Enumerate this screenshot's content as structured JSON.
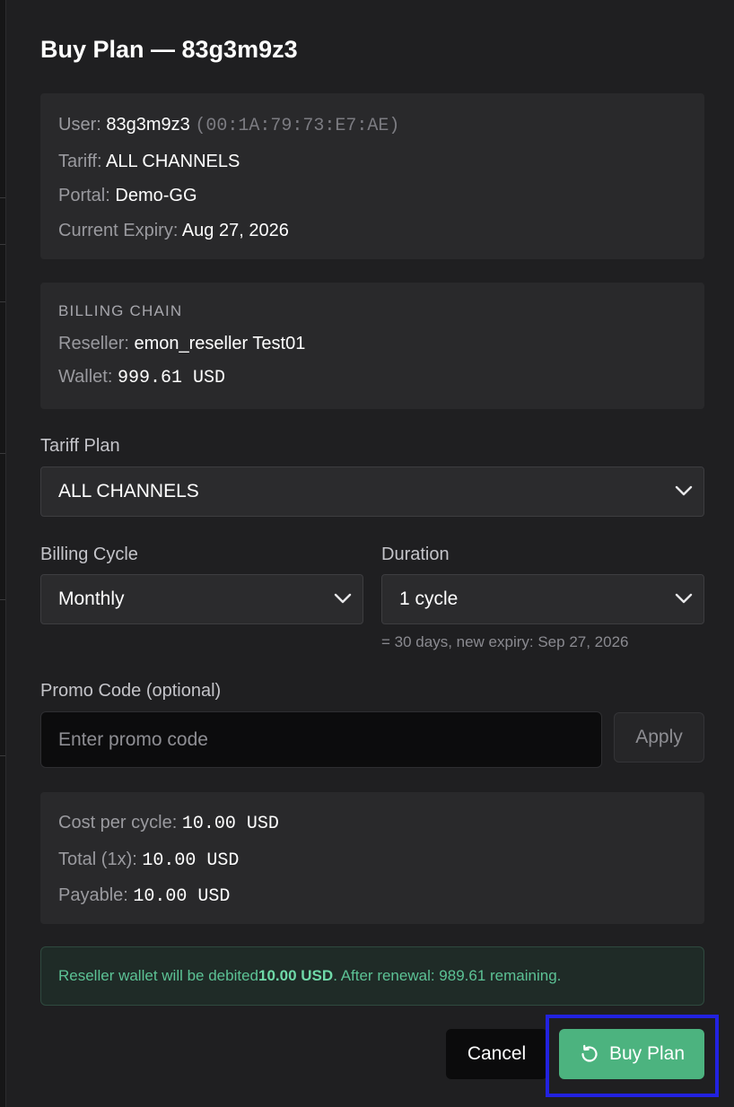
{
  "modal": {
    "title": "Buy Plan — 83g3m9z3"
  },
  "user_info": {
    "user_label": "User:",
    "user_value": "83g3m9z3",
    "mac": "(00:1A:79:73:E7:AE)",
    "tariff_label": "Tariff:",
    "tariff_value": "ALL CHANNELS",
    "portal_label": "Portal:",
    "portal_value": "Demo-GG",
    "expiry_label": "Current Expiry:",
    "expiry_value": "Aug 27, 2026"
  },
  "billing_chain": {
    "heading": "BILLING CHAIN",
    "reseller_label": "Reseller:",
    "reseller_value": "emon_reseller Test01",
    "wallet_label": "Wallet:",
    "wallet_value": "999.61 USD"
  },
  "form": {
    "tariff_plan_label": "Tariff Plan",
    "tariff_plan_value": "ALL CHANNELS",
    "billing_cycle_label": "Billing Cycle",
    "billing_cycle_value": "Monthly",
    "duration_label": "Duration",
    "duration_value": "1 cycle",
    "duration_hint": "= 30 days, new expiry: Sep 27, 2026",
    "promo_label": "Promo Code (optional)",
    "promo_placeholder": "Enter promo code",
    "apply_label": "Apply"
  },
  "summary": {
    "cost_label": "Cost per cycle:",
    "cost_value": "10.00 USD",
    "total_label": "Total (1x):",
    "total_value": "10.00 USD",
    "payable_label": "Payable:",
    "payable_value": "10.00 USD"
  },
  "notice": {
    "prefix": "Reseller wallet will be debited ",
    "amount": "10.00 USD",
    "suffix": ". After renewal: 989.61 remaining."
  },
  "actions": {
    "cancel_label": "Cancel",
    "buy_label": "Buy Plan"
  },
  "colors": {
    "accent": "#4cb37f",
    "highlight": "#2222e0"
  },
  "icons": {
    "chevron": "chevron-down-icon",
    "buy": "refresh-icon"
  }
}
